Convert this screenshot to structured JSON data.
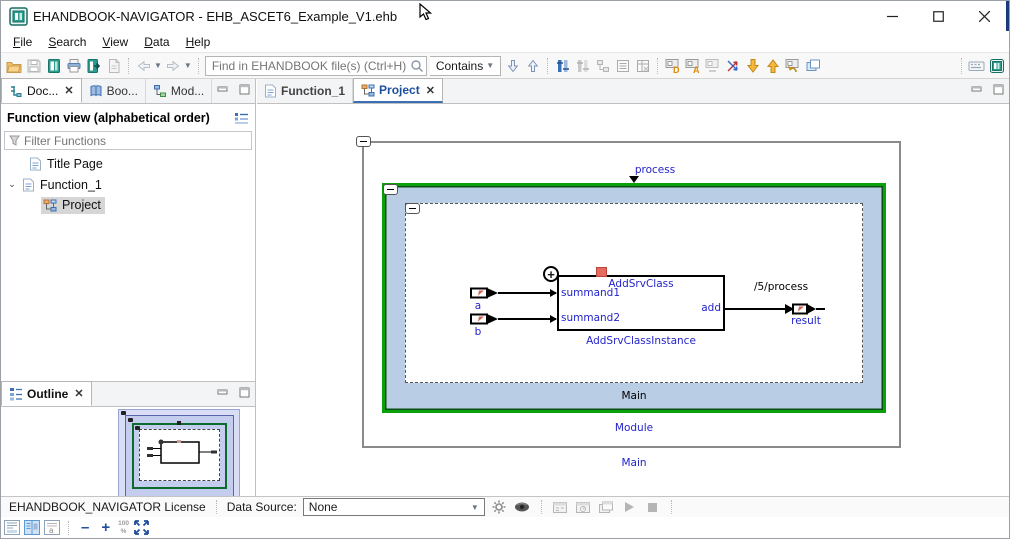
{
  "window": {
    "title": "EHANDBOOK-NAVIGATOR - EHB_ASCET6_Example_V1.ehb",
    "minimize": "–",
    "maximize": "❐",
    "close": "✕"
  },
  "menu": {
    "items": [
      {
        "mnemonic": "F",
        "rest": "ile"
      },
      {
        "mnemonic": "S",
        "rest": "earch"
      },
      {
        "mnemonic": "V",
        "rest": "iew"
      },
      {
        "mnemonic": "D",
        "rest": "ata"
      },
      {
        "mnemonic": "H",
        "rest": "elp"
      }
    ]
  },
  "toolbar": {
    "search_placeholder": "Find in EHANDBOOK file(s) (Ctrl+H)",
    "contains_label": "Contains",
    "icons": [
      "open-folder",
      "save",
      "ehb-book",
      "print",
      "export-book",
      "pdf-export",
      "nav-back",
      "nav-forward",
      "search",
      "find-next",
      "find-prev",
      "breakpoints",
      "sliders-gray",
      "hierarchy-gray",
      "list-view",
      "table-view",
      "diagram-show-defaults",
      "diagram-show-annotations",
      "diagram-gray",
      "cross-arrows",
      "go-down",
      "go-up",
      "back-to-diagram",
      "open-new-view",
      "keyboard-shortcuts",
      "ehb-info"
    ]
  },
  "left_panel": {
    "tabs": [
      {
        "label": "Doc...",
        "active": true
      },
      {
        "label": "Boo..."
      },
      {
        "label": "Mod..."
      }
    ],
    "header": "Function view (alphabetical order)",
    "filter_placeholder": "Filter Functions",
    "tree": [
      {
        "label": "Title Page",
        "icon": "document"
      },
      {
        "label": "Function_1",
        "icon": "document",
        "expanded": true
      },
      {
        "label": "Project",
        "icon": "diagram",
        "selected": true
      }
    ]
  },
  "outline": {
    "tab_label": "Outline"
  },
  "editor": {
    "tabs": [
      {
        "label": "Function_1",
        "active": false
      },
      {
        "label": "Project",
        "active": true
      }
    ]
  },
  "diagram": {
    "process_label": "process",
    "main_inner_label": "Main",
    "module_label": "Module",
    "main_outer_label": "Main",
    "block": {
      "class_label": "AddSrvClass",
      "instance_label": "AddSrvClassInstance",
      "port_in1": "summand1",
      "port_in2": "summand2",
      "port_out": "add"
    },
    "connector_a": "a",
    "connector_b": "b",
    "connector_result": "result",
    "wire_label": "/5/process",
    "colors": {
      "module_green": "#0ca10c",
      "module_fill": "#b9cee4",
      "label_blue": "#2323cc",
      "marker_red": "#e8695f"
    }
  },
  "statusbar": {
    "license": "EHANDBOOK_NAVIGATOR License",
    "data_source_label": "Data Source:",
    "data_source_value": "None",
    "zoom_out": "–",
    "zoom_in": "+",
    "zoom_pct_top": "100",
    "zoom_pct_bottom": "%"
  }
}
